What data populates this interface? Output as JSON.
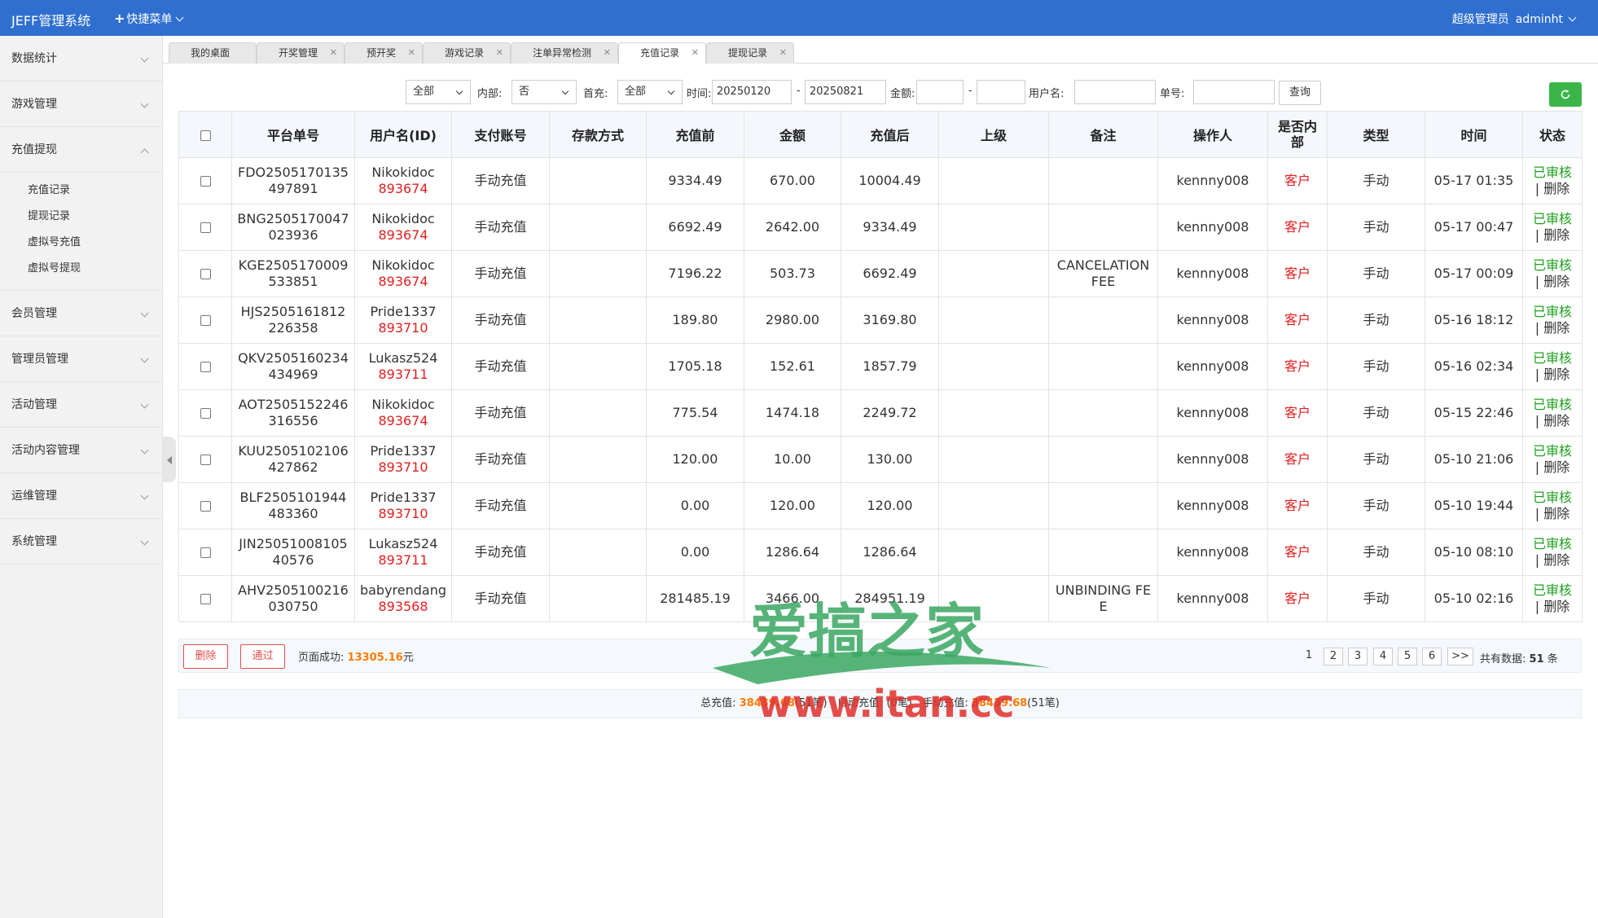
{
  "header": {
    "app_title": "JEFF管理系统",
    "quick_menu_label": "快捷菜单",
    "role": "超级管理员",
    "username": "adminht"
  },
  "sidebar": {
    "items": [
      {
        "label": "数据统计"
      },
      {
        "label": "游戏管理"
      },
      {
        "label": "充值提现",
        "submenu": [
          "充值记录",
          "提现记录",
          "虚拟号充值",
          "虚拟号提现"
        ]
      },
      {
        "label": "会员管理"
      },
      {
        "label": "管理员管理"
      },
      {
        "label": "活动管理"
      },
      {
        "label": "活动内容管理"
      },
      {
        "label": "运维管理"
      },
      {
        "label": "系统管理"
      }
    ]
  },
  "tabs": [
    "我的桌面",
    "开奖管理",
    "预开奖",
    "游戏记录",
    "注单异常检测",
    "充值记录",
    "提现记录"
  ],
  "filters": {
    "status_value": "全部",
    "internal_label": "内部:",
    "internal_value": "否",
    "first_deposit_label": "首充:",
    "first_deposit_value": "全部",
    "time_label": "时间:",
    "date_from": "20250120",
    "range_sep": "-",
    "date_to": "20250821",
    "amount_label": "金额:",
    "amount_sep": "-",
    "username_label": "用户名:",
    "order_label": "单号:",
    "query_button": "查询"
  },
  "table": {
    "headers": [
      "平台单号",
      "用户名(ID)",
      "支付账号",
      "存款方式",
      "充值前",
      "金额",
      "充值后",
      "上级",
      "备注",
      "操作人",
      "是否内部",
      "类型",
      "时间",
      "状态"
    ],
    "rows": [
      {
        "order": "FDO2505170135497891",
        "user": "Nikokidoc",
        "uid": "893674",
        "account": "手动充值",
        "method": "",
        "before": "9334.49",
        "amount": "670.00",
        "after": "10004.49",
        "parent": "",
        "remark": "",
        "operator": "kennny008",
        "internal": "客户",
        "type": "手动",
        "time": "05-17 01:35",
        "status": "已审核",
        "delete": "删除"
      },
      {
        "order": "BNG2505170047023936",
        "user": "Nikokidoc",
        "uid": "893674",
        "account": "手动充值",
        "method": "",
        "before": "6692.49",
        "amount": "2642.00",
        "after": "9334.49",
        "parent": "",
        "remark": "",
        "operator": "kennny008",
        "internal": "客户",
        "type": "手动",
        "time": "05-17 00:47",
        "status": "已审核",
        "delete": "删除"
      },
      {
        "order": "KGE2505170009533851",
        "user": "Nikokidoc",
        "uid": "893674",
        "account": "手动充值",
        "method": "",
        "before": "7196.22",
        "amount": "503.73",
        "after": "6692.49",
        "parent": "",
        "remark": "CANCELATION FEE",
        "operator": "kennny008",
        "internal": "客户",
        "type": "手动",
        "time": "05-17 00:09",
        "status": "已审核",
        "delete": "删除"
      },
      {
        "order": "HJS2505161812226358",
        "user": "Pride1337",
        "uid": "893710",
        "account": "手动充值",
        "method": "",
        "before": "189.80",
        "amount": "2980.00",
        "after": "3169.80",
        "parent": "",
        "remark": "",
        "operator": "kennny008",
        "internal": "客户",
        "type": "手动",
        "time": "05-16 18:12",
        "status": "已审核",
        "delete": "删除"
      },
      {
        "order": "QKV2505160234434969",
        "user": "Lukasz524",
        "uid": "893711",
        "account": "手动充值",
        "method": "",
        "before": "1705.18",
        "amount": "152.61",
        "after": "1857.79",
        "parent": "",
        "remark": "",
        "operator": "kennny008",
        "internal": "客户",
        "type": "手动",
        "time": "05-16 02:34",
        "status": "已审核",
        "delete": "删除"
      },
      {
        "order": "AOT2505152246316556",
        "user": "Nikokidoc",
        "uid": "893674",
        "account": "手动充值",
        "method": "",
        "before": "775.54",
        "amount": "1474.18",
        "after": "2249.72",
        "parent": "",
        "remark": "",
        "operator": "kennny008",
        "internal": "客户",
        "type": "手动",
        "time": "05-15 22:46",
        "status": "已审核",
        "delete": "删除"
      },
      {
        "order": "KUU2505102106427862",
        "user": "Pride1337",
        "uid": "893710",
        "account": "手动充值",
        "method": "",
        "before": "120.00",
        "amount": "10.00",
        "after": "130.00",
        "parent": "",
        "remark": "",
        "operator": "kennny008",
        "internal": "客户",
        "type": "手动",
        "time": "05-10 21:06",
        "status": "已审核",
        "delete": "删除"
      },
      {
        "order": "BLF2505101944483360",
        "user": "Pride1337",
        "uid": "893710",
        "account": "手动充值",
        "method": "",
        "before": "0.00",
        "amount": "120.00",
        "after": "120.00",
        "parent": "",
        "remark": "",
        "operator": "kennny008",
        "internal": "客户",
        "type": "手动",
        "time": "05-10 19:44",
        "status": "已审核",
        "delete": "删除"
      },
      {
        "order": "JIN2505100810540576",
        "user": "Lukasz524",
        "uid": "893711",
        "account": "手动充值",
        "method": "",
        "before": "0.00",
        "amount": "1286.64",
        "after": "1286.64",
        "parent": "",
        "remark": "",
        "operator": "kennny008",
        "internal": "客户",
        "type": "手动",
        "time": "05-10 08:10",
        "status": "已审核",
        "delete": "删除"
      },
      {
        "order": "AHV2505100216030750",
        "user": "babyrendang",
        "uid": "893568",
        "account": "手动充值",
        "method": "",
        "before": "281485.19",
        "amount": "3466.00",
        "after": "284951.19",
        "parent": "",
        "remark": "UNBINDING FEE",
        "operator": "kennny008",
        "internal": "客户",
        "type": "手动",
        "time": "05-10 02:16",
        "status": "已审核",
        "delete": "删除"
      }
    ]
  },
  "footer": {
    "delete_button": "删除",
    "approve_button": "通过",
    "page_success_label": "页面成功:",
    "page_success_value": "13305.16",
    "currency": "元",
    "pages": [
      "1",
      "2",
      "3",
      "4",
      "5",
      "6",
      ">>"
    ],
    "total_label": "共有数据:",
    "total_value": "51",
    "total_unit": "条"
  },
  "summary": {
    "total_label": "总充值:",
    "total_value": "38439.68",
    "total_count": "(51笔)",
    "auto_label": "自动充值:",
    "auto_count": "(0笔)",
    "manual_label": "手动充值:",
    "manual_value": "38439.68",
    "manual_count": "(51笔)"
  },
  "watermark": {
    "title": "爱搞之家",
    "url": "www.itan.cc"
  },
  "colors": {
    "topbar": "#2f6fd0",
    "status_ok": "#1ea01e",
    "uid_red": "#e02020",
    "highlight_orange": "#ff7a00",
    "refresh_green": "#3bb54a"
  }
}
